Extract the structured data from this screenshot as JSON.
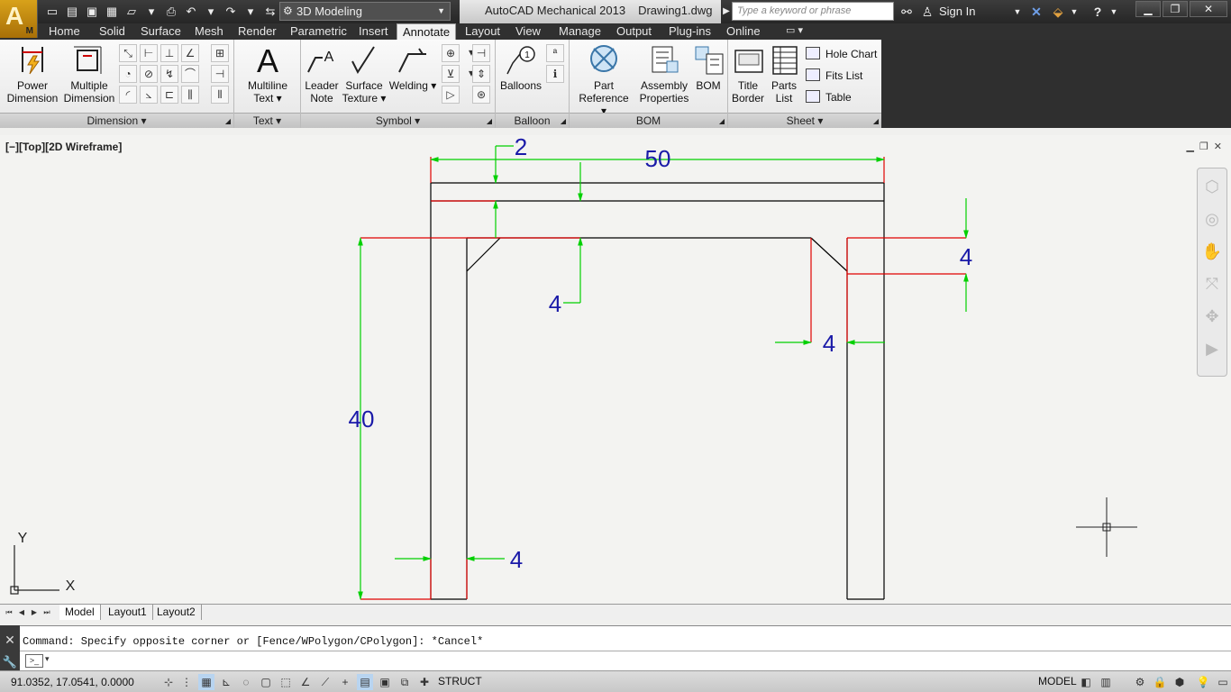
{
  "app": {
    "logo_letter": "A",
    "logo_sub": "M",
    "title": "AutoCAD Mechanical 2013",
    "filename": "Drawing1.dwg",
    "workspace": "3D Modeling",
    "search_placeholder": "Type a keyword or phrase",
    "sign_in": "Sign In"
  },
  "ribbon_tabs": [
    "Home",
    "Solid",
    "Surface",
    "Mesh",
    "Render",
    "Parametric",
    "Insert",
    "Annotate",
    "Layout",
    "View",
    "Manage",
    "Output",
    "Plug-ins",
    "Online"
  ],
  "active_tab": "Annotate",
  "panels": {
    "dimension": {
      "title": "Dimension",
      "power_dimension": [
        "Power",
        "Dimension"
      ],
      "multiple_dimension": [
        "Multiple",
        "Dimension"
      ]
    },
    "text": {
      "title": "Text",
      "multiline_text": [
        "Multiline",
        "Text"
      ]
    },
    "symbol": {
      "title": "Symbol",
      "leader_note": [
        "Leader",
        "Note"
      ],
      "surface_texture": [
        "Surface",
        "Texture"
      ],
      "welding": "Welding"
    },
    "balloon": {
      "title": "Balloon",
      "balloons": "Balloons"
    },
    "bom": {
      "title": "BOM",
      "part_reference": [
        "Part",
        "Reference"
      ],
      "assembly_properties": [
        "Assembly",
        "Properties"
      ],
      "bom": "BOM"
    },
    "sheet": {
      "title": "Sheet",
      "title_border": [
        "Title",
        "Border"
      ],
      "parts_list": [
        "Parts",
        "List"
      ],
      "hole_chart": "Hole Chart",
      "fits_list": "Fits List",
      "table": "Table"
    }
  },
  "viewport": {
    "label": "[−][Top][2D Wireframe]"
  },
  "drawing": {
    "dimensions": [
      "2",
      "50",
      "4",
      "4",
      "4",
      "40",
      "4"
    ],
    "ucs_x": "X",
    "ucs_y": "Y"
  },
  "layout_tabs": [
    "Model",
    "Layout1",
    "Layout2"
  ],
  "command": {
    "history": "Command: Specify opposite corner or [Fence/WPolygon/CPolygon]: *Cancel*"
  },
  "status": {
    "coords": "91.0352, 17.0541, 0.0000",
    "struct": "STRUCT",
    "model": "MODEL"
  },
  "colors": {
    "dim_line": "#00d000",
    "dim_text": "#1a1aa8",
    "centerline": "#e00000",
    "geometry": "#000000",
    "ribbon_dark": "#303030"
  }
}
